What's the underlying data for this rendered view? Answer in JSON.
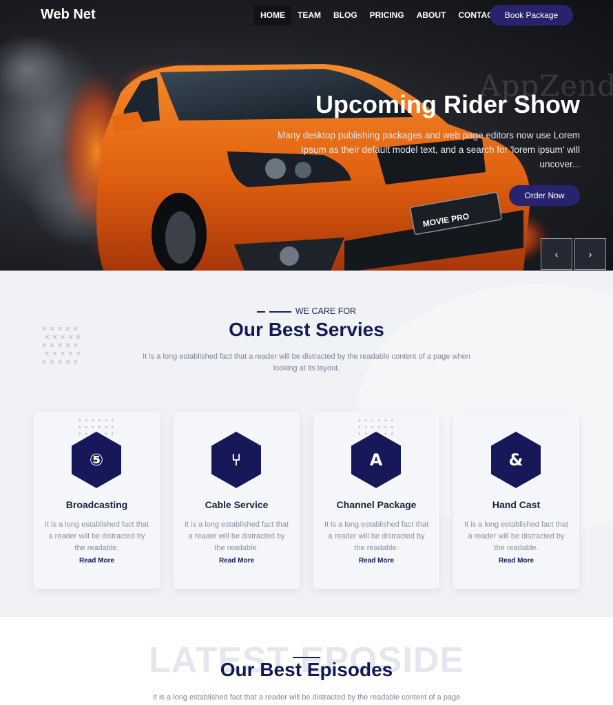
{
  "navbar": {
    "brand": "Web Net",
    "links": [
      "HOME",
      "TEAM",
      "BLOG",
      "PRICING",
      "ABOUT",
      "CONTACT"
    ],
    "active_link": "HOME",
    "cta_label": "Book Package"
  },
  "hero": {
    "watermark": "AppZend",
    "title": "Upcoming Rider Show",
    "description": "Many desktop publishing packages and web page editors now use Lorem Ipsum as their default model text, and a search for 'lorem ipsum' will uncover...",
    "order_label": "Order Now",
    "plate_text": "MOVIE PRO",
    "prev_icon": "‹",
    "next_icon": "›"
  },
  "services": {
    "subtitle": "WE CARE FOR",
    "title": "Our Best Servies",
    "description": "It is a long established fact that a reader will be distracted by the readable content of a page when looking at its layout.",
    "cards": [
      {
        "title": "Broadcasting",
        "text": "It is a long established fact that a reader will be distracted by the readable.",
        "link": "Read More",
        "icon": "broadcast-icon",
        "glyph": "⑤"
      },
      {
        "title": "Cable Service",
        "text": "It is a long established fact that a reader will be distracted by the readable.",
        "link": "Read More",
        "icon": "cable-icon",
        "glyph": "⑂"
      },
      {
        "title": "Channel Package",
        "text": "It is a long established fact that a reader will be distracted by the readable.",
        "link": "Read More",
        "icon": "channel-icon",
        "glyph": "A"
      },
      {
        "title": "Hand Cast",
        "text": "It is a long established fact that a reader will be distracted by the readable.",
        "link": "Read More",
        "icon": "handcast-icon",
        "glyph": "&"
      }
    ]
  },
  "episodes": {
    "bg_text": "LATEST EPOSIDE",
    "title": "Our Best Episodes",
    "description": "It is a long established fact that a reader will be distracted by the readable content of a page"
  },
  "colors": {
    "accent": "#27246d",
    "navy": "#17185a",
    "car_orange": "#e8651a",
    "section_bg": "#f1f2f6"
  }
}
